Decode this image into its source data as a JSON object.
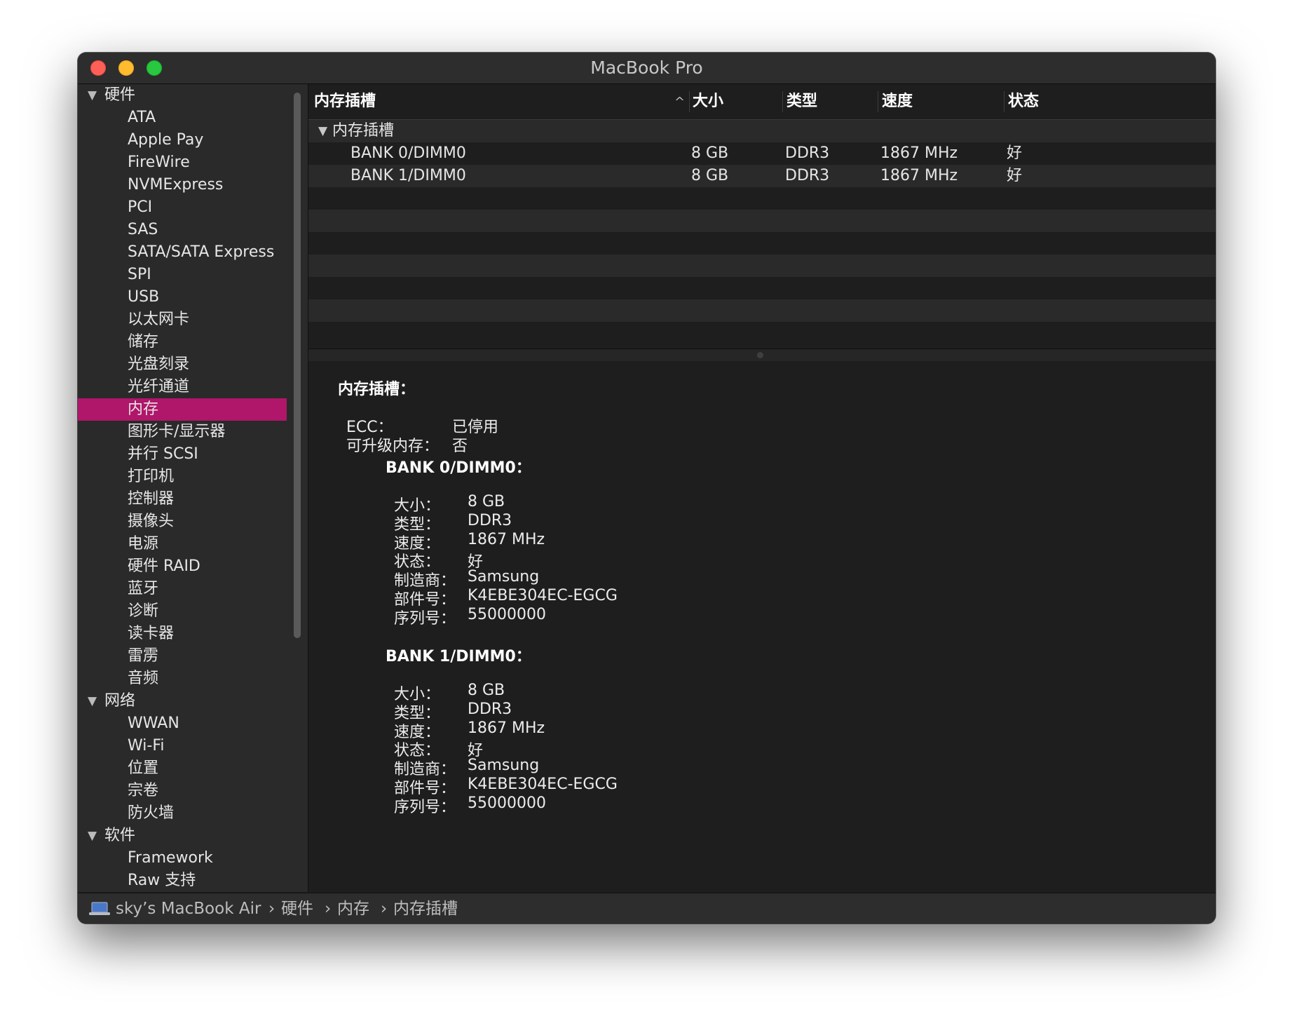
{
  "window": {
    "title": "MacBook Pro"
  },
  "sidebar": {
    "rows": [
      {
        "type": "group",
        "label": "硬件"
      },
      {
        "type": "item",
        "label": "ATA"
      },
      {
        "type": "item",
        "label": "Apple Pay"
      },
      {
        "type": "item",
        "label": "FireWire"
      },
      {
        "type": "item",
        "label": "NVMExpress"
      },
      {
        "type": "item",
        "label": "PCI"
      },
      {
        "type": "item",
        "label": "SAS"
      },
      {
        "type": "item",
        "label": "SATA/SATA Express"
      },
      {
        "type": "item",
        "label": "SPI"
      },
      {
        "type": "item",
        "label": "USB"
      },
      {
        "type": "item",
        "label": "以太网卡"
      },
      {
        "type": "item",
        "label": "储存"
      },
      {
        "type": "item",
        "label": "光盘刻录"
      },
      {
        "type": "item",
        "label": "光纤通道"
      },
      {
        "type": "item",
        "label": "内存",
        "selected": true
      },
      {
        "type": "item",
        "label": "图形卡/显示器"
      },
      {
        "type": "item",
        "label": "并行 SCSI"
      },
      {
        "type": "item",
        "label": "打印机"
      },
      {
        "type": "item",
        "label": "控制器"
      },
      {
        "type": "item",
        "label": "摄像头"
      },
      {
        "type": "item",
        "label": "电源"
      },
      {
        "type": "item",
        "label": "硬件 RAID"
      },
      {
        "type": "item",
        "label": "蓝牙"
      },
      {
        "type": "item",
        "label": "诊断"
      },
      {
        "type": "item",
        "label": "读卡器"
      },
      {
        "type": "item",
        "label": "雷雳"
      },
      {
        "type": "item",
        "label": "音频"
      },
      {
        "type": "group",
        "label": "网络"
      },
      {
        "type": "item",
        "label": "WWAN"
      },
      {
        "type": "item",
        "label": "Wi-Fi"
      },
      {
        "type": "item",
        "label": "位置"
      },
      {
        "type": "item",
        "label": "宗卷"
      },
      {
        "type": "item",
        "label": "防火墙"
      },
      {
        "type": "group",
        "label": "软件"
      },
      {
        "type": "item",
        "label": "Framework"
      },
      {
        "type": "item",
        "label": "Raw 支持"
      }
    ],
    "selected_color": "#b0166a"
  },
  "table": {
    "columns": [
      "内存插槽",
      "大小",
      "类型",
      "速度",
      "状态"
    ],
    "sort_indicator": "^",
    "group_label": "内存插槽",
    "rows": [
      {
        "slot": "BANK 0/DIMM0",
        "size": "8 GB",
        "type": "DDR3",
        "speed": "1867 MHz",
        "status": "好"
      },
      {
        "slot": "BANK 1/DIMM0",
        "size": "8 GB",
        "type": "DDR3",
        "speed": "1867 MHz",
        "status": "好"
      }
    ]
  },
  "detail": {
    "heading": "内存插槽：",
    "summary": [
      {
        "key": "ECC：",
        "value": "已停用"
      },
      {
        "key": "可升级内存：",
        "value": "否"
      }
    ],
    "banks": [
      {
        "title": "BANK 0/DIMM0：",
        "fields": [
          {
            "key": "大小：",
            "value": "8 GB"
          },
          {
            "key": "类型：",
            "value": "DDR3"
          },
          {
            "key": "速度：",
            "value": "1867 MHz"
          },
          {
            "key": "状态：",
            "value": "好"
          },
          {
            "key": "制造商：",
            "value": "Samsung"
          },
          {
            "key": "部件号：",
            "value": "K4EBE304EC-EGCG"
          },
          {
            "key": "序列号：",
            "value": "55000000"
          }
        ]
      },
      {
        "title": "BANK 1/DIMM0：",
        "fields": [
          {
            "key": "大小：",
            "value": "8 GB"
          },
          {
            "key": "类型：",
            "value": "DDR3"
          },
          {
            "key": "速度：",
            "value": "1867 MHz"
          },
          {
            "key": "状态：",
            "value": "好"
          },
          {
            "key": "制造商：",
            "value": "Samsung"
          },
          {
            "key": "部件号：",
            "value": "K4EBE304EC-EGCG"
          },
          {
            "key": "序列号：",
            "value": "55000000"
          }
        ]
      }
    ]
  },
  "statusbar": {
    "icon": "laptop-icon",
    "crumbs": [
      "sky’s MacBook Air",
      "硬件",
      "内存",
      "内存插槽"
    ],
    "separator": "›"
  }
}
